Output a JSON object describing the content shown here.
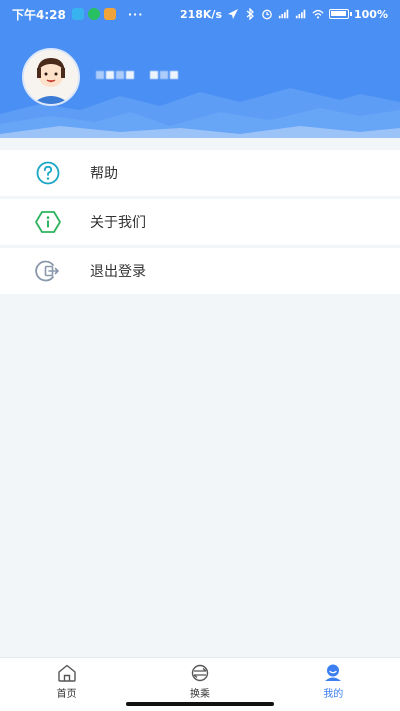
{
  "status_bar": {
    "time": "下午4:28",
    "more": "···",
    "net_speed": "218K/s",
    "battery": "100",
    "battery_unit": "%"
  },
  "profile": {
    "username_masked": ""
  },
  "menu": [
    {
      "label": "帮助",
      "icon": "help-icon",
      "color": "#1aa6c4"
    },
    {
      "label": "关于我们",
      "icon": "info-icon",
      "color": "#2db35d"
    },
    {
      "label": "退出登录",
      "icon": "logout-icon",
      "color": "#8a98ab"
    }
  ],
  "tabs": [
    {
      "label": "首页",
      "icon": "home-icon",
      "active": false
    },
    {
      "label": "换乘",
      "icon": "transfer-icon",
      "active": false
    },
    {
      "label": "我的",
      "icon": "profile-icon",
      "active": true
    }
  ],
  "colors": {
    "header_bg": "#4a8ff3",
    "accent": "#3d7ff0",
    "page_bg": "#f3f6f9"
  }
}
